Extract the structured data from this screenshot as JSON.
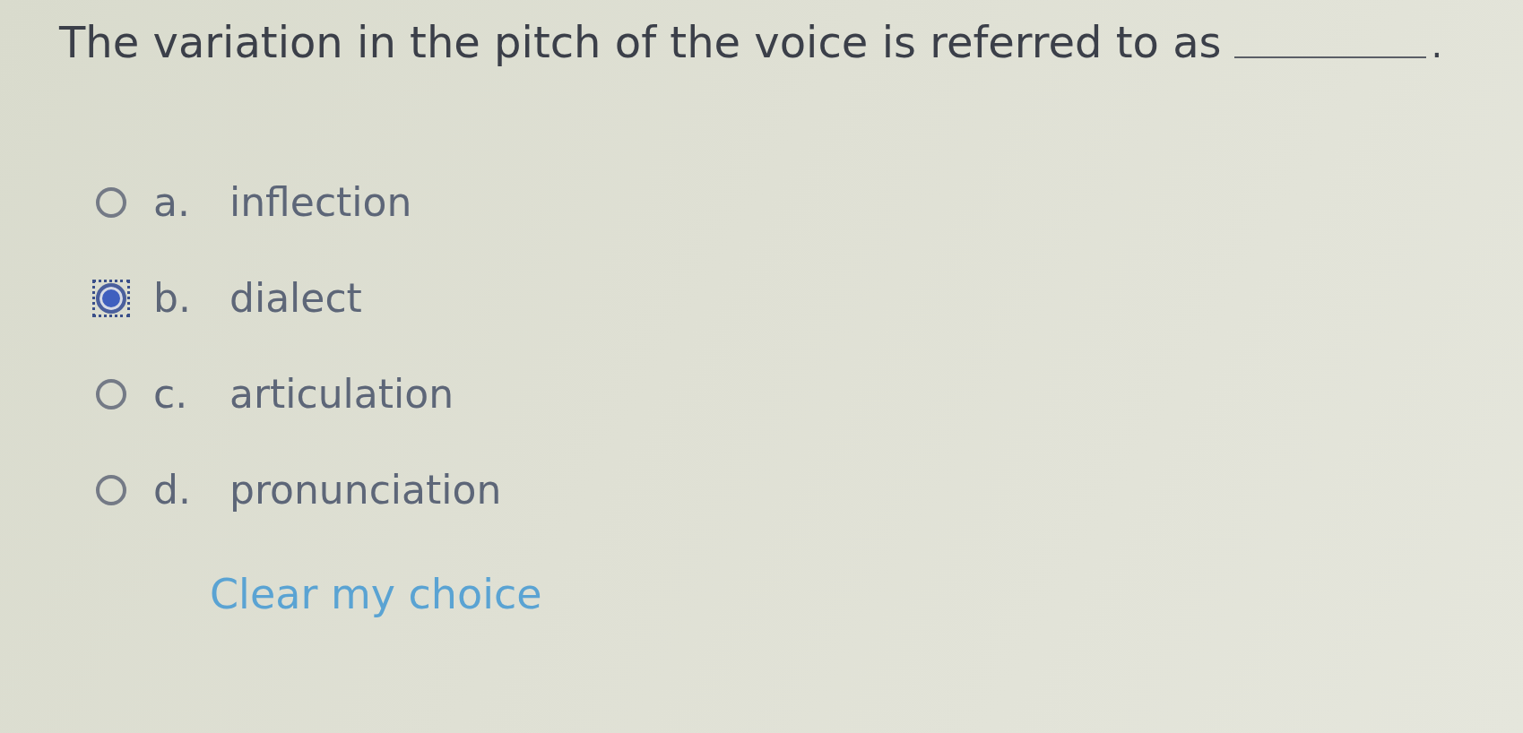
{
  "question": {
    "text": "The variation in the pitch of the voice is referred to as",
    "end": "."
  },
  "options": [
    {
      "letter": "a.",
      "text": "inflection",
      "selected": false
    },
    {
      "letter": "b.",
      "text": "dialect",
      "selected": true
    },
    {
      "letter": "c.",
      "text": "articulation",
      "selected": false
    },
    {
      "letter": "d.",
      "text": "pronunciation",
      "selected": false
    }
  ],
  "clear_link": "Clear my choice"
}
